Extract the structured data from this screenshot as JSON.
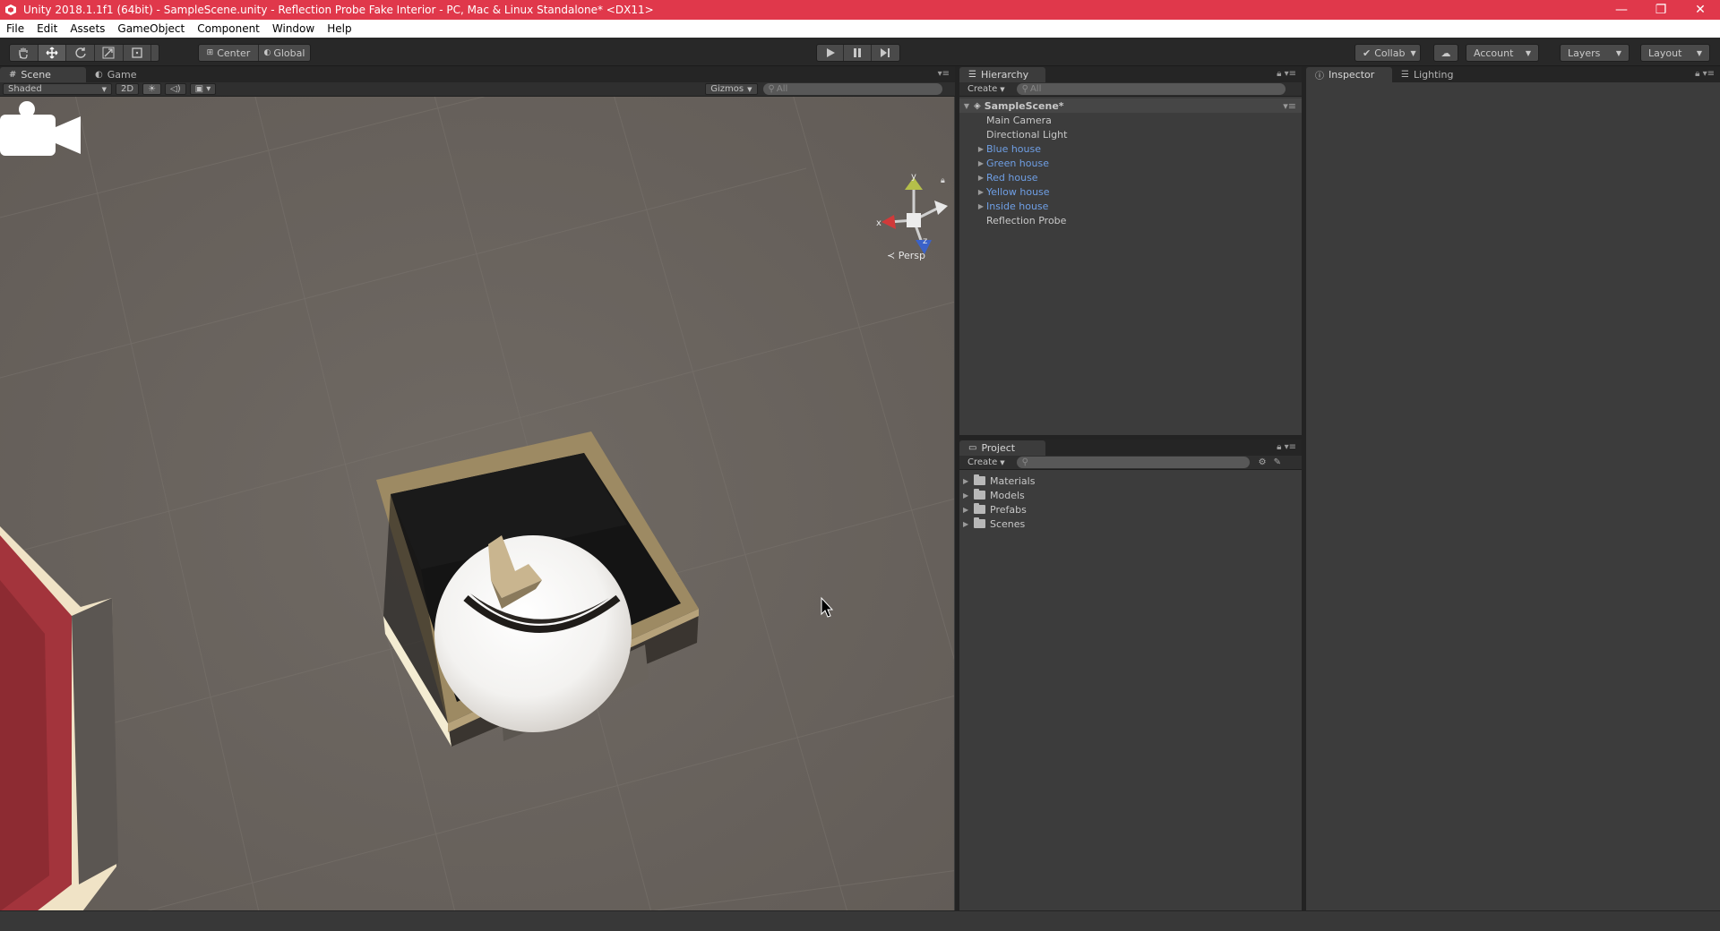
{
  "window": {
    "title": "Unity 2018.1.1f1 (64bit) - SampleScene.unity - Reflection Probe Fake Interior - PC, Mac & Linux Standalone* <DX11>",
    "minimize": "—",
    "restore": "❐",
    "close": "✕"
  },
  "menubar": {
    "items": [
      "File",
      "Edit",
      "Assets",
      "GameObject",
      "Component",
      "Window",
      "Help"
    ]
  },
  "toolbar": {
    "pivot_mode": "Center",
    "pivot_rotation": "Global",
    "collab": "Collab",
    "account": "Account",
    "layers": "Layers",
    "layout": "Layout"
  },
  "scene": {
    "tab_scene": "Scene",
    "tab_game": "Game",
    "shading_mode": "Shaded",
    "mode_2d": "2D",
    "gizmos": "Gizmos",
    "search_placeholder": "All",
    "gizmo_y": "y",
    "gizmo_x": "x",
    "gizmo_z": "z",
    "projection": "Persp"
  },
  "hierarchy": {
    "tab": "Hierarchy",
    "create": "Create",
    "search_placeholder": "All",
    "scene_name": "SampleScene*",
    "items": [
      {
        "label": "Main Camera"
      },
      {
        "label": "Directional Light"
      },
      {
        "label": "Blue house"
      },
      {
        "label": "Green house"
      },
      {
        "label": "Red house"
      },
      {
        "label": "Yellow house"
      },
      {
        "label": "Inside house"
      },
      {
        "label": "Reflection Probe"
      }
    ]
  },
  "project": {
    "tab": "Project",
    "create": "Create",
    "folders": [
      "Materials",
      "Models",
      "Prefabs",
      "Scenes"
    ]
  },
  "inspector": {
    "tab_inspector": "Inspector",
    "tab_lighting": "Lighting"
  },
  "colors": {
    "title_bar": "#e0384b",
    "prefab_text": "#6f9fe5",
    "ground": "#6b6560"
  }
}
